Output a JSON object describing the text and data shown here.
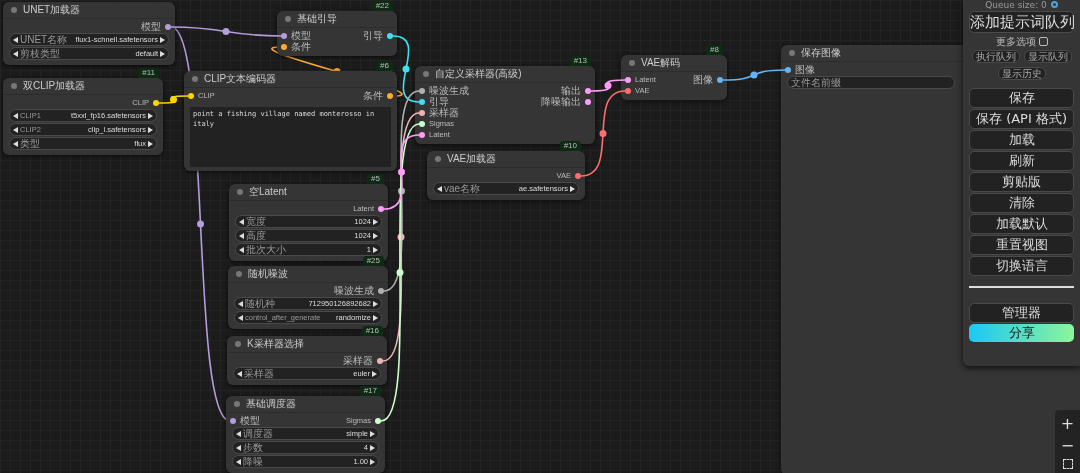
{
  "nodes": [
    {
      "title": "UNET加载器",
      "outputs": [
        {
          "label": "模型",
          "color": "#b39ddb"
        }
      ],
      "widgets": [
        {
          "kind": "stepper",
          "label": "UNET名称",
          "value": "flux1-schnell.safetensors"
        },
        {
          "kind": "stepper",
          "label": "剪枝类型",
          "value": "default"
        }
      ]
    },
    {
      "title": "基础引导",
      "badge": "#22",
      "inputs": [
        {
          "label": "模型",
          "color": "#b39ddb"
        },
        {
          "label": "条件",
          "color": "#ffa931"
        }
      ],
      "outputs": [
        {
          "label": "引导",
          "color": "#40e0f0"
        }
      ]
    },
    {
      "title": "双CLIP加载器",
      "badge": "#11",
      "outputs": [
        {
          "label": "CLIP",
          "color": "#ffd500"
        }
      ],
      "widgets": [
        {
          "kind": "stepper",
          "label": "CLIP1",
          "value": "t5xxl_fp16.safetensors"
        },
        {
          "kind": "stepper",
          "label": "CLIP2",
          "value": "clip_l.safetensors"
        },
        {
          "kind": "stepper",
          "label": "类型",
          "value": "flux"
        }
      ]
    },
    {
      "title": "CLIP文本编码器",
      "badge": "#6",
      "inputs": [
        {
          "label": "CLIP",
          "color": "#ffd500"
        }
      ],
      "outputs": [
        {
          "label": "条件",
          "color": "#ffa931"
        }
      ],
      "prompt": "point a fishing village named monterosso in italy"
    },
    {
      "title": "自定义采样器(高级)",
      "badge": "#13",
      "inputs": [
        {
          "label": "噪波生成",
          "color": "#b0b0b0"
        },
        {
          "label": "引导",
          "color": "#40e0f0"
        },
        {
          "label": "采样器",
          "color": "#ecb4b4"
        },
        {
          "label": "Sigmas",
          "color": "#cdffcd"
        },
        {
          "label": "Latent",
          "color": "#ff9cf9"
        }
      ],
      "outputs": [
        {
          "label": "输出",
          "color": "#ff9cf9"
        },
        {
          "label": "降噪输出",
          "color": "#ff9cf9"
        }
      ]
    },
    {
      "title": "VAE解码",
      "badge": "#8",
      "inputs": [
        {
          "label": "Latent",
          "color": "#ff9cf9"
        },
        {
          "label": "VAE",
          "color": "#ff6e6e"
        }
      ],
      "outputs": [
        {
          "label": "图像",
          "color": "#64b5f6"
        }
      ]
    },
    {
      "title": "VAE加载器",
      "badge": "#10",
      "outputs": [
        {
          "label": "VAE",
          "color": "#ff6e6e"
        }
      ],
      "widgets": [
        {
          "kind": "stepper",
          "label": "vae名称",
          "value": "ae.safetensors"
        }
      ]
    },
    {
      "title": "保存图像",
      "inputs": [
        {
          "label": "图像",
          "color": "#64b5f6"
        }
      ],
      "widgets": [
        {
          "kind": "text",
          "label": "文件名前缀"
        }
      ]
    },
    {
      "title": "空Latent",
      "badge": "#5",
      "outputs": [
        {
          "label": "Latent",
          "color": "#ff9cf9"
        }
      ],
      "widgets": [
        {
          "kind": "stepper",
          "label": "宽度",
          "value": "1024"
        },
        {
          "kind": "stepper",
          "label": "高度",
          "value": "1024"
        },
        {
          "kind": "stepper",
          "label": "批次大小",
          "value": "1"
        }
      ]
    },
    {
      "title": "随机噪波",
      "badge": "#25",
      "outputs": [
        {
          "label": "噪波生成",
          "color": "#b0b0b0"
        }
      ],
      "widgets": [
        {
          "kind": "stepper",
          "label": "随机种",
          "value": "712950126892682"
        },
        {
          "kind": "stepper",
          "label": "control_after_generate",
          "value": "randomize"
        }
      ]
    },
    {
      "title": "K采样器选择",
      "badge": "#16",
      "outputs": [
        {
          "label": "采样器",
          "color": "#ecb4b4"
        }
      ],
      "widgets": [
        {
          "kind": "stepper",
          "label": "采样器",
          "value": "euler"
        }
      ]
    },
    {
      "title": "基础调度器",
      "badge": "#17",
      "inputs": [
        {
          "label": "模型",
          "color": "#b39ddb"
        }
      ],
      "outputs": [
        {
          "label": "Sigmas",
          "color": "#cdffcd"
        }
      ],
      "widgets": [
        {
          "kind": "stepper",
          "label": "调度器",
          "value": "simple"
        },
        {
          "kind": "stepper",
          "label": "步数",
          "value": "4"
        },
        {
          "kind": "stepper",
          "label": "降噪",
          "value": "1.00"
        }
      ]
    }
  ],
  "side_panel": {
    "queue_status": "Queue size: 0",
    "queue_button": "添加提示词队列",
    "more_options": {
      "label": "更多选项",
      "checked": false
    },
    "small_buttons": [
      "执行队列",
      "显示队列",
      "显示历史"
    ],
    "buttons": [
      "保存",
      "保存 (API 格式)",
      "加载",
      "刷新",
      "剪贴版",
      "清除",
      "加载默认",
      "重置视图",
      "切换语言"
    ],
    "manager_button": "管理器",
    "share_button": "分享"
  },
  "zoom_controls": [
    "+",
    "−"
  ]
}
